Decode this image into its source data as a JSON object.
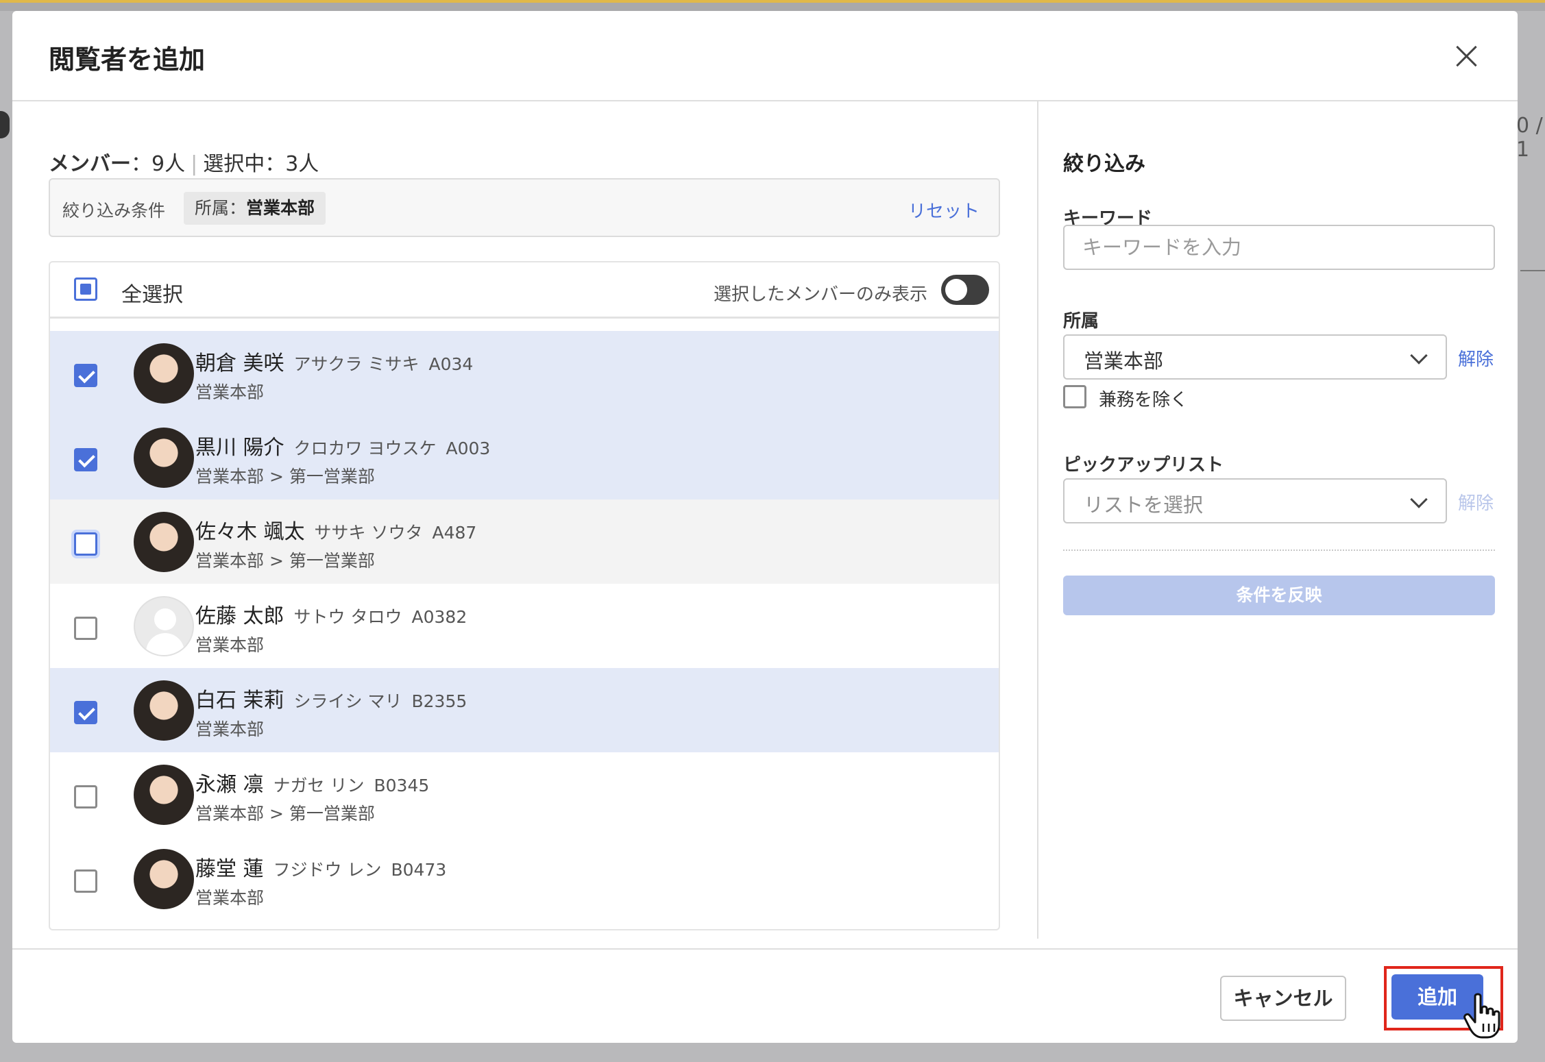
{
  "dialog": {
    "title": "閲覧者を追加"
  },
  "summary": {
    "members_label": "メンバー",
    "members_value": "：9人",
    "selected_label": "選択中",
    "selected_value": "：3人",
    "separator": "|"
  },
  "filter_bar": {
    "label": "絞り込み条件",
    "chip_key": "所属：",
    "chip_value": "営業本部",
    "reset_label": "リセット"
  },
  "list_header": {
    "select_all_label": "全選択",
    "select_all_state": "indeterminate",
    "toggle_label": "選択したメンバーのみ表示",
    "toggle_on": false
  },
  "members": [
    {
      "name": "朝倉 美咲",
      "kana": "アサクラ ミサキ",
      "code": "A034",
      "dept": "営業本部",
      "checked": true
    },
    {
      "name": "黒川 陽介",
      "kana": "クロカワ ヨウスケ",
      "code": "A003",
      "dept": "営業本部 > 第一営業部",
      "checked": true
    },
    {
      "name": "佐々木 颯太",
      "kana": "ササキ ソウタ",
      "code": "A487",
      "dept": "営業本部 > 第一営業部",
      "checked": false
    },
    {
      "name": "佐藤 太郎",
      "kana": "サトウ タロウ",
      "code": "A0382",
      "dept": "営業本部",
      "checked": false
    },
    {
      "name": "白石 茉莉",
      "kana": "シライシ マリ",
      "code": "B2355",
      "dept": "営業本部",
      "checked": true
    },
    {
      "name": "永瀬 凛",
      "kana": "ナガセ リン",
      "code": "B0345",
      "dept": "営業本部 > 第一営業部",
      "checked": false
    },
    {
      "name": "藤堂 蓮",
      "kana": "フジドウ レン",
      "code": "B0473",
      "dept": "営業本部",
      "checked": false
    }
  ],
  "filter_panel": {
    "title": "絞り込み",
    "keyword_label": "キーワード",
    "keyword_placeholder": "キーワードを入力",
    "keyword_value": "",
    "department_label": "所属",
    "department_value": "営業本部",
    "department_clear": "解除",
    "exclude_label": "兼務を除く",
    "pickup_label": "ピックアップリスト",
    "pickup_placeholder": "リストを選択",
    "pickup_clear": "解除",
    "apply_label": "条件を反映"
  },
  "footer": {
    "cancel_label": "キャンセル",
    "add_label": "追加"
  },
  "background": {
    "right_edge_text": "0 / 1"
  },
  "colors": {
    "accent": "#4a70d9",
    "selected_row": "#e3e9f7",
    "highlight": "#e0261b"
  }
}
